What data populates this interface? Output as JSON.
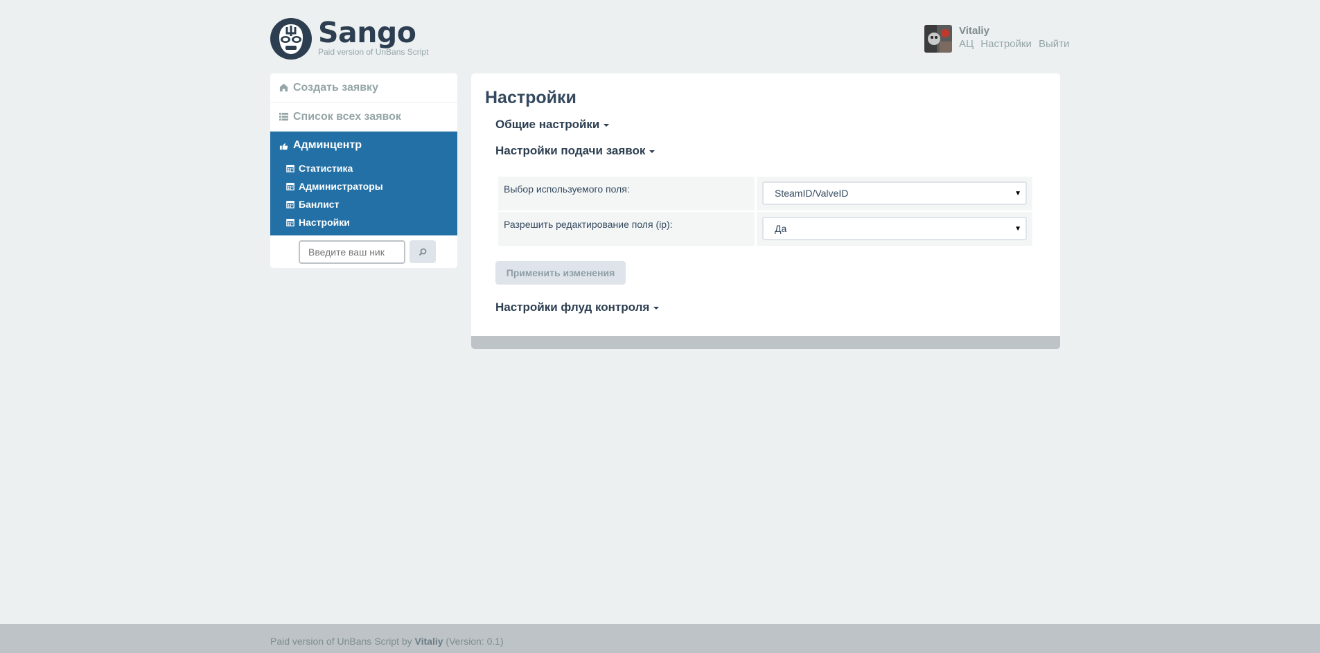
{
  "header": {
    "logo_name": "Sango",
    "logo_subtitle": "Paid version of UnBans Script"
  },
  "user": {
    "name": "Vitaliy",
    "links": [
      "АЦ",
      "Настройки",
      "Выйти"
    ]
  },
  "sidebar": {
    "items": [
      {
        "label": "Создать заявку",
        "icon": "home-icon"
      },
      {
        "label": "Список всех заявок",
        "icon": "list-icon"
      }
    ],
    "active": {
      "label": "Админцентр",
      "icon": "admin-hand-icon",
      "sub_items": [
        {
          "label": "Статистика",
          "icon": "calendar-icon"
        },
        {
          "label": "Администраторы",
          "icon": "calendar-icon"
        },
        {
          "label": "Банлист",
          "icon": "calendar-icon"
        },
        {
          "label": "Настройки",
          "icon": "calendar-icon"
        }
      ]
    },
    "search": {
      "placeholder": "Введите ваш ник",
      "icon": "search-icon"
    }
  },
  "main": {
    "title": "Настройки",
    "sections": {
      "general": "Общие настройки",
      "submission": "Настройки подачи заявок",
      "flood": "Настройки флуд контроля"
    },
    "rows": [
      {
        "label": "Выбор используемого поля:",
        "value": "SteamID/ValveID"
      },
      {
        "label": "Разрешить редактирование поля (ip):",
        "value": "Да"
      }
    ],
    "apply_label": "Применить изменения"
  },
  "footer": {
    "prefix": "Paid version of UnBans Script by ",
    "author": "Vitaliy",
    "suffix": " (Version: 0.1)"
  },
  "colors": {
    "accent": "#2270a6",
    "background": "#ecf0f1",
    "footer": "#bdc3c7"
  }
}
